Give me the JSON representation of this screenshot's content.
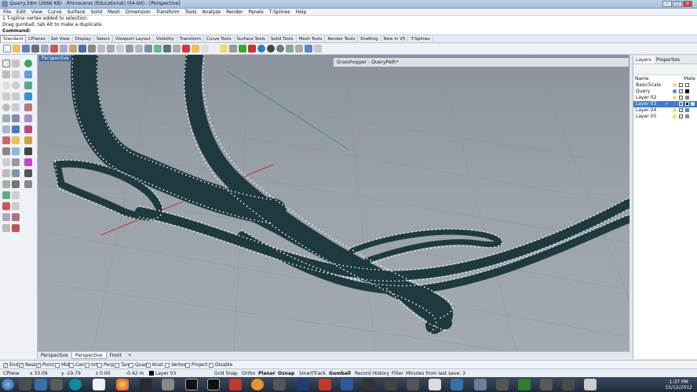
{
  "window": {
    "title": "Quarry.3dm (2666 KB) - Rhinoceros (Educational) (64-bit) - [Perspective]",
    "min": "–",
    "max": "□",
    "close": "x"
  },
  "menu": [
    "File",
    "Edit",
    "View",
    "Curve",
    "Surface",
    "Solid",
    "Mesh",
    "Dimension",
    "Transform",
    "Tools",
    "Analyze",
    "Render",
    "Panels",
    "T-Splines",
    "Help"
  ],
  "command": {
    "history": [
      "1 T-spline vertex added to selection.",
      "Drag gumball, tab Alt to make a duplicate."
    ],
    "prompt": "Command:"
  },
  "tabs": [
    "Standard",
    "CPlanes",
    "Set View",
    "Display",
    "Select",
    "Viewport Layout",
    "Visibility",
    "Transform",
    "Curve Tools",
    "Surface Tools",
    "Solid Tools",
    "Mesh Tools",
    "Render Tools",
    "Drafting",
    "New in V5",
    "T-Splines"
  ],
  "viewport": {
    "label": "Perspective",
    "bottom_tabs": [
      "Perspective",
      "Perspective",
      "Front"
    ],
    "add_tab": "+"
  },
  "grasshopper": {
    "title": "Grasshopper - QueryPath*"
  },
  "layers_panel": {
    "tabs": [
      "Layers",
      "Properties"
    ],
    "columns": [
      "Name",
      "Mate"
    ],
    "layers": [
      {
        "name": "BasicScale",
        "color": "#ffffff"
      },
      {
        "name": "Query",
        "color": "#000000"
      },
      {
        "name": "Layer 02",
        "color": "#888888"
      },
      {
        "name": "Layer 03",
        "color": "#000000",
        "selected": true
      },
      {
        "name": "Layer 04",
        "color": "#3a8fd8"
      },
      {
        "name": "Layer 05",
        "color": "#888888"
      }
    ]
  },
  "osnaps": [
    {
      "label": "End",
      "checked": true
    },
    {
      "label": "Near",
      "checked": true
    },
    {
      "label": "Point",
      "checked": true
    },
    {
      "label": "Mid",
      "checked": false
    },
    {
      "label": "Cen",
      "checked": false
    },
    {
      "label": "Int",
      "checked": false
    },
    {
      "label": "Perp",
      "checked": false
    },
    {
      "label": "Tan",
      "checked": false
    },
    {
      "label": "Quad",
      "checked": false
    },
    {
      "label": "Knot",
      "checked": false
    },
    {
      "label": "Vertex",
      "checked": false
    },
    {
      "label": "Project",
      "checked": false
    },
    {
      "label": "Disable",
      "checked": false
    }
  ],
  "status": {
    "cplane": "CPlane",
    "x": "x 33.09",
    "y": "y -29.79",
    "z": "z 0.00",
    "dist": "-0.42 m",
    "layer": "Layer 03",
    "grid_snap": "Grid Snap",
    "ortho": "Ortho",
    "planar": "Planar",
    "osnap": "Osnap",
    "smarttrack": "SmartTrack",
    "gumball": "Gumball",
    "record_history": "Record History",
    "filter": "Filter",
    "minutes": "Minutes from last save: 3"
  },
  "clock": {
    "time": "1:37 PM",
    "date": "15/12/2012"
  },
  "colors": {
    "accent": "#3a7bd5",
    "model": "#1e3a3e",
    "vertex": "#ffffff",
    "axis_x": "#c0392b",
    "axis_y": "#2ea043"
  }
}
